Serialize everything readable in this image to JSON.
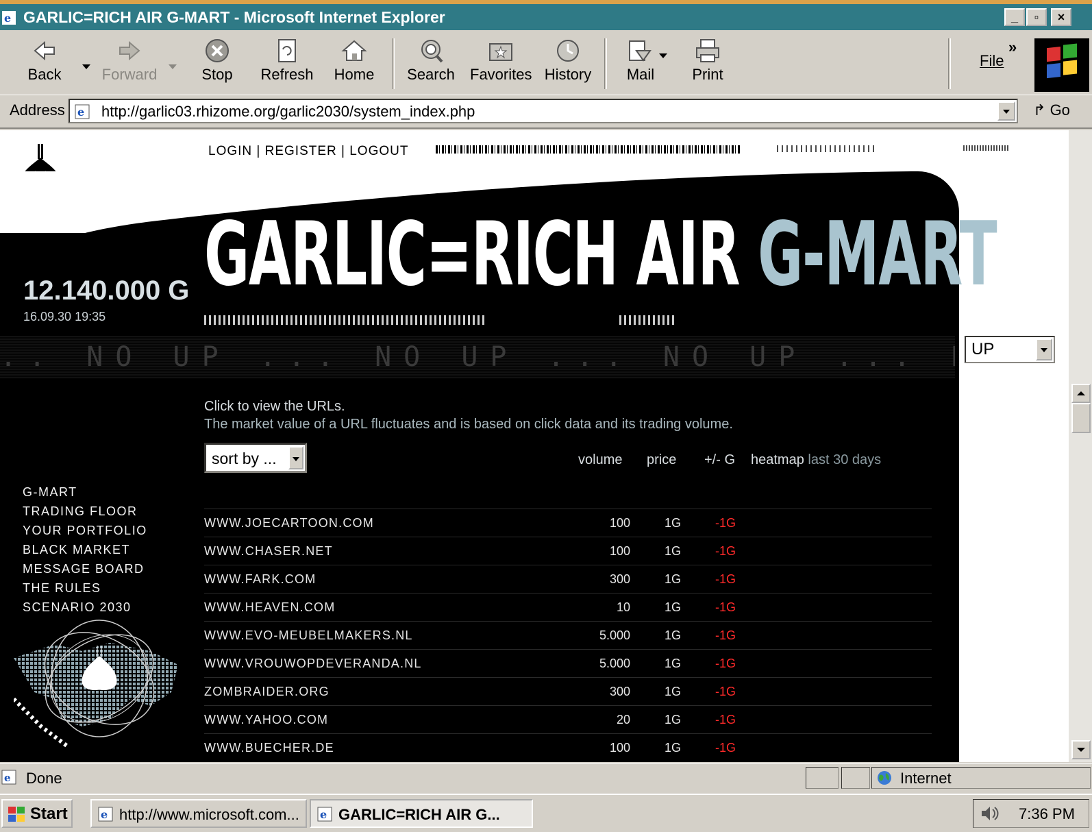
{
  "window": {
    "title": "GARLIC=RICH AIR G-MART - Microsoft Internet Explorer",
    "min": "_",
    "max": "▫",
    "close": "×"
  },
  "toolbar": {
    "back": "Back",
    "forward": "Forward",
    "stop": "Stop",
    "refresh": "Refresh",
    "home": "Home",
    "search": "Search",
    "favorites": "Favorites",
    "history": "History",
    "mail": "Mail",
    "print": "Print",
    "file": "File",
    "chevron": "»"
  },
  "address": {
    "label": "Address",
    "url": "http://garlic03.rhizome.org/garlic2030/system_index.php",
    "go": "Go"
  },
  "page": {
    "toplinks": "LOGIN | REGISTER | LOGOUT",
    "balance": "12.140.000 G",
    "timestamp": "16.09.30 19:35",
    "hero_white": "GARLIC=RICH AIR ",
    "hero_blue": "G-MART",
    "ticker": ".. NO UP ... NO UP ... NO UP ... NO UP ..",
    "up_select": "UP",
    "info_line1": "Click to view the URLs.",
    "info_line2": "The market value of a URL fluctuates and is based on click data and its trading volume.",
    "sort_select": "sort by ...",
    "columns": {
      "volume": "volume",
      "price": "price",
      "change": "+/- G",
      "heatmap": "heatmap",
      "heatmap_sub": "last 30 days"
    },
    "menu": [
      "G-MART",
      "TRADING FLOOR",
      "YOUR PORTFOLIO",
      "BLACK MARKET",
      "MESSAGE BOARD",
      "THE RULES",
      "SCENARIO 2030"
    ],
    "rows": [
      {
        "url": "WWW.JOECARTOON.COM",
        "volume": "100",
        "price": "1G",
        "change": "-1G"
      },
      {
        "url": "WWW.CHASER.NET",
        "volume": "100",
        "price": "1G",
        "change": "-1G"
      },
      {
        "url": "WWW.FARK.COM",
        "volume": "300",
        "price": "1G",
        "change": "-1G"
      },
      {
        "url": "WWW.HEAVEN.COM",
        "volume": "10",
        "price": "1G",
        "change": "-1G"
      },
      {
        "url": "WWW.EVO-MEUBELMAKERS.NL",
        "volume": "5.000",
        "price": "1G",
        "change": "-1G"
      },
      {
        "url": "WWW.VROUWOPDEVERANDA.NL",
        "volume": "5.000",
        "price": "1G",
        "change": "-1G"
      },
      {
        "url": "ZOMBRAIDER.ORG",
        "volume": "300",
        "price": "1G",
        "change": "-1G"
      },
      {
        "url": "WWW.YAHOO.COM",
        "volume": "20",
        "price": "1G",
        "change": "-1G"
      },
      {
        "url": "WWW.BUECHER.DE",
        "volume": "100",
        "price": "1G",
        "change": "-1G"
      }
    ]
  },
  "status": {
    "text": "Done",
    "zone": "Internet"
  },
  "taskbar": {
    "start": "Start",
    "tasks": [
      "http://www.microsoft.com...",
      "GARLIC=RICH AIR G..."
    ],
    "clock": "7:36 PM"
  },
  "colors": {
    "titlebar": "#2f7a86",
    "chrome": "#d4d0c8",
    "hero_blue": "#a9c4cf",
    "change_red": "#ff2a2a",
    "desktop": "#dca24a"
  }
}
